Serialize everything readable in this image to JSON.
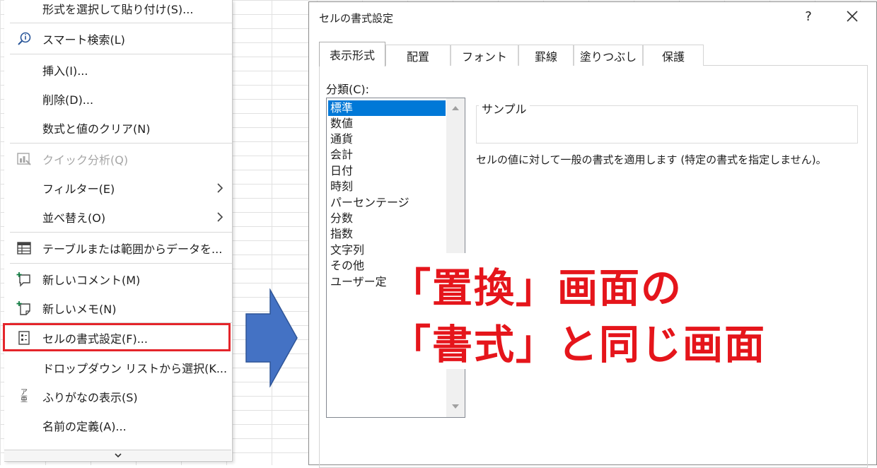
{
  "context_menu": {
    "items": [
      {
        "label": "形式を選択して貼り付け(S)...",
        "icon": ""
      },
      {
        "label": "スマート検索(L)",
        "icon": "smart-search-icon"
      },
      {
        "label": "挿入(I)...",
        "icon": ""
      },
      {
        "label": "削除(D)...",
        "icon": ""
      },
      {
        "label": "数式と値のクリア(N)",
        "icon": ""
      },
      {
        "label": "クイック分析(Q)",
        "icon": "quick-analysis-icon",
        "disabled": true
      },
      {
        "label": "フィルター(E)",
        "icon": "",
        "submenu": true
      },
      {
        "label": "並べ替え(O)",
        "icon": "",
        "submenu": true
      },
      {
        "label": "テーブルまたは範囲からデータを...",
        "icon": "table-icon"
      },
      {
        "label": "新しいコメント(M)",
        "icon": "new-comment-icon"
      },
      {
        "label": "新しいメモ(N)",
        "icon": "new-note-icon"
      },
      {
        "label": "セルの書式設定(F)...",
        "icon": "format-cells-icon",
        "highlighted": true
      },
      {
        "label": "ドロップダウン リストから選択(K...",
        "icon": ""
      },
      {
        "label": "ふりがなの表示(S)",
        "icon": "furigana-icon"
      },
      {
        "label": "名前の定義(A)...",
        "icon": ""
      }
    ],
    "furigana_glyph_top": "ア",
    "furigana_glyph_bottom": "亜",
    "highlight_color": "#e4252b"
  },
  "dialog": {
    "title": "セルの書式設定",
    "help_label": "?",
    "tabs": [
      "表示形式",
      "配置",
      "フォント",
      "罫線",
      "塗りつぶし",
      "保護"
    ],
    "active_tab": "表示形式",
    "category_label": "分類(C):",
    "categories": [
      "標準",
      "数値",
      "通貨",
      "会計",
      "日付",
      "時刻",
      "パーセンテージ",
      "分数",
      "指数",
      "文字列",
      "その他",
      "ユーザー定義"
    ],
    "selected_category": "標準",
    "sample_label": "サンプル",
    "description": "セルの値に対して一般の書式を適用します (特定の書式を指定しません)。",
    "selection_color": "#0078d7"
  },
  "annotation": {
    "line1": "「置換」画面の",
    "line2": "「書式」と同じ画面",
    "color": "#e5151b"
  },
  "arrow_color": "#4472c4"
}
